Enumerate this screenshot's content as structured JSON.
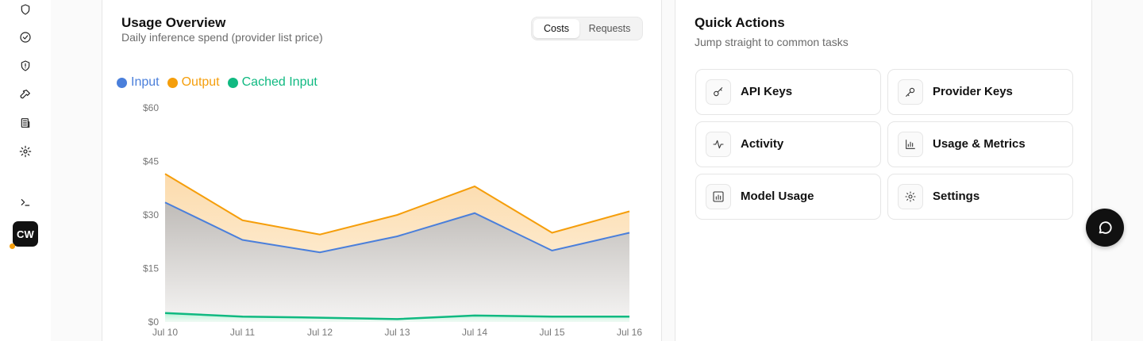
{
  "sidebar": {
    "items": [
      {
        "name": "shield-icon"
      },
      {
        "name": "check-circle-icon"
      },
      {
        "name": "shield-alert-icon"
      },
      {
        "name": "key-icon"
      },
      {
        "name": "building-icon"
      },
      {
        "name": "gear-icon"
      },
      {
        "name": "terminal-icon"
      }
    ],
    "avatar_initials": "CW",
    "status_color": "#f59e0b"
  },
  "usage": {
    "title": "Usage Overview",
    "subtitle": "Daily inference spend (provider list price)",
    "tabs": [
      {
        "label": "Costs",
        "active": true
      },
      {
        "label": "Requests",
        "active": false
      }
    ]
  },
  "quick_actions": {
    "title": "Quick Actions",
    "subtitle": "Jump straight to common tasks",
    "items": [
      {
        "label": "API Keys",
        "icon": "key-icon"
      },
      {
        "label": "Provider Keys",
        "icon": "key-alt-icon"
      },
      {
        "label": "Activity",
        "icon": "activity-icon"
      },
      {
        "label": "Usage & Metrics",
        "icon": "bar-chart-icon"
      },
      {
        "label": "Model Usage",
        "icon": "bar-chart-box-icon"
      },
      {
        "label": "Settings",
        "icon": "gear-icon"
      }
    ]
  },
  "chat": {
    "icon": "chat-bubble-icon"
  },
  "chart_data": {
    "type": "area",
    "stacked": true,
    "categories": [
      "Jul 10",
      "Jul 11",
      "Jul 12",
      "Jul 13",
      "Jul 14",
      "Jul 15",
      "Jul 16"
    ],
    "y_ticks": [
      "$0",
      "$15",
      "$30",
      "$45",
      "$60"
    ],
    "ylim": [
      0,
      60
    ],
    "series": [
      {
        "name": "Input",
        "color": "#4a7fdb",
        "values": [
          33.5,
          23,
          19.5,
          24,
          30.5,
          20,
          25
        ]
      },
      {
        "name": "Output",
        "color": "#f59e0b",
        "values": [
          8,
          5.5,
          5,
          6,
          7.5,
          5,
          6
        ]
      },
      {
        "name": "Cached Input",
        "color": "#10b981",
        "values": [
          2.5,
          1.5,
          1.2,
          0.8,
          1.8,
          1.5,
          1.5
        ]
      }
    ],
    "grid": false,
    "legend_position": "top-left"
  }
}
